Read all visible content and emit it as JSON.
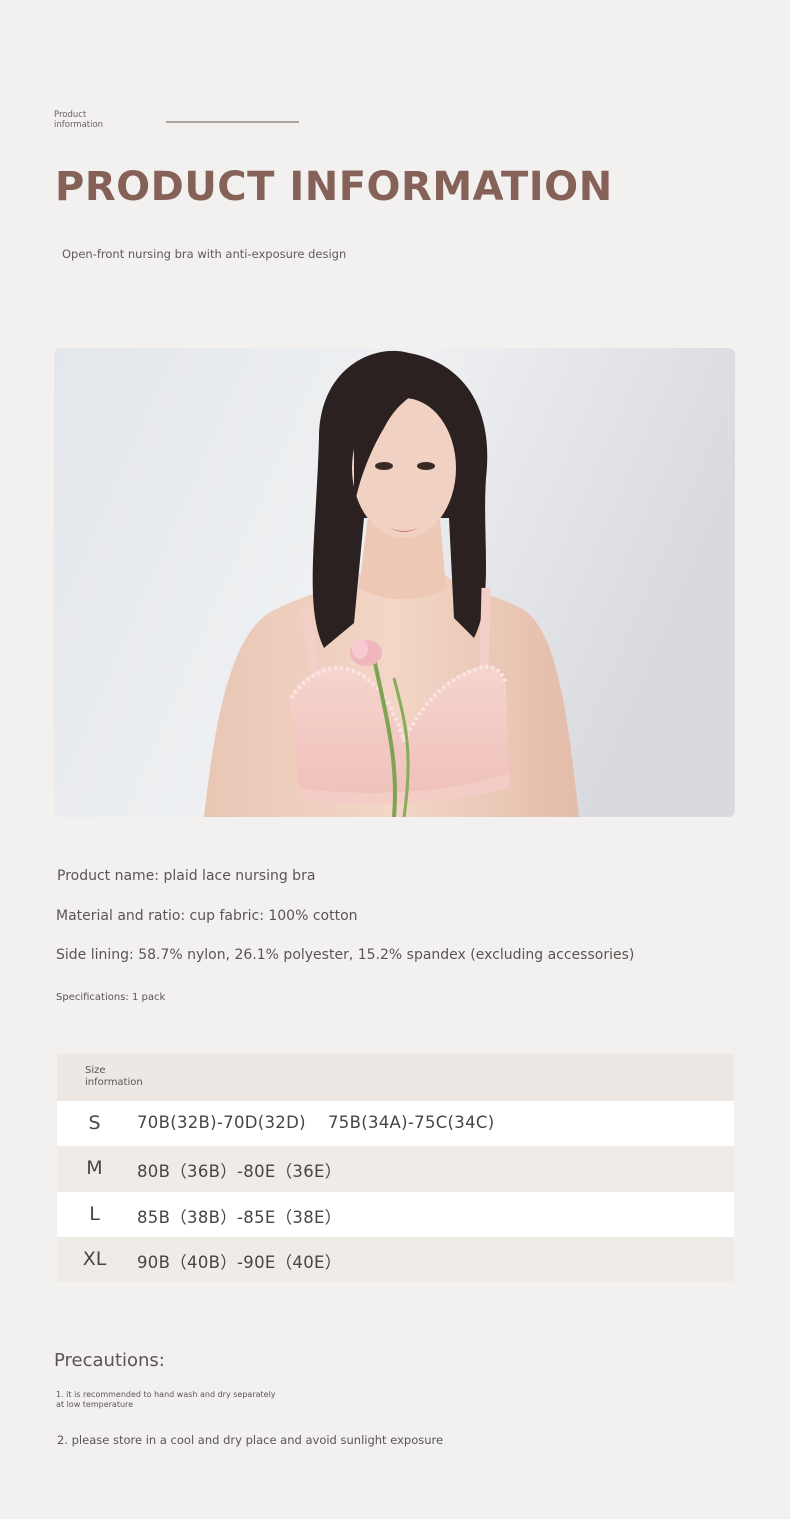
{
  "header": {
    "small_label": "Product information",
    "title": "PRODUCT INFORMATION",
    "subtitle": "Open-front nursing bra with anti-exposure design"
  },
  "image": {
    "subject": "model-photo"
  },
  "details": {
    "product_name": "Product name: plaid lace nursing bra",
    "material": "Material and ratio: cup fabric: 100% cotton",
    "side_lining": "Side lining: 58.7% nylon, 26.1% polyester, 15.2% spandex (excluding accessories)",
    "specifications": "Specifications: 1 pack"
  },
  "size_table": {
    "header": "Size information",
    "rows": [
      {
        "size": "S",
        "range": "70B(32B)-70D(32D)    75B(34A)-75C(34C)"
      },
      {
        "size": "M",
        "range": "80B（36B）-80E（36E）"
      },
      {
        "size": "L",
        "range": "85B（38B）-85E（38E）"
      },
      {
        "size": "XL",
        "range": "90B（40B）-90E（40E）"
      }
    ]
  },
  "precautions": {
    "title": "Precautions:",
    "items": [
      "1. it is recommended to hand wash and dry separately at low temperature",
      "2. please store in a cool and dry place and avoid sunlight exposure"
    ]
  },
  "colors": {
    "background": "#f2f1f0",
    "title": "#866158",
    "table_beige": "#efebe6",
    "table_white": "#ffffff"
  }
}
